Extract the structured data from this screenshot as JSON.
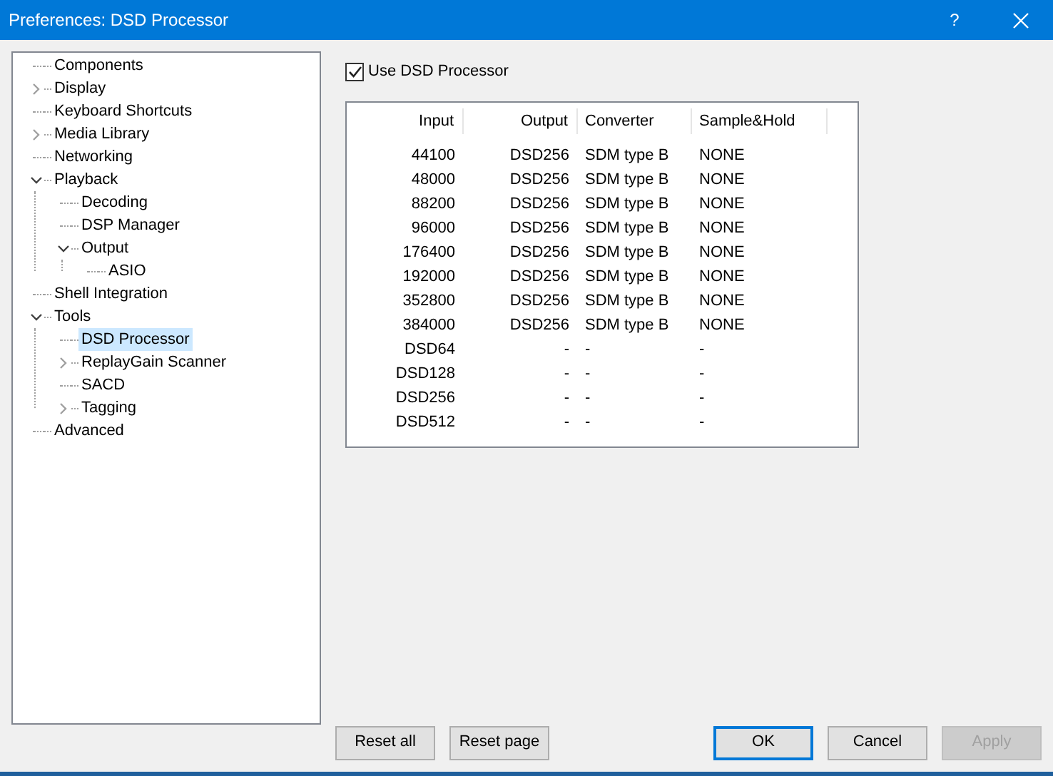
{
  "window": {
    "title": "Preferences: DSD Processor",
    "help": "?"
  },
  "tree": [
    {
      "label": "Components",
      "selected": false
    },
    {
      "label": "Display",
      "selected": false,
      "expanded": false
    },
    {
      "label": "Keyboard Shortcuts",
      "selected": false
    },
    {
      "label": "Media Library",
      "selected": false,
      "expanded": false
    },
    {
      "label": "Networking",
      "selected": false
    },
    {
      "label": "Playback",
      "selected": false,
      "expanded": true,
      "children": [
        {
          "label": "Decoding",
          "selected": false
        },
        {
          "label": "DSP Manager",
          "selected": false
        },
        {
          "label": "Output",
          "selected": false,
          "expanded": true,
          "children": [
            {
              "label": "ASIO",
              "selected": false
            }
          ]
        }
      ]
    },
    {
      "label": "Shell Integration",
      "selected": false
    },
    {
      "label": "Tools",
      "selected": false,
      "expanded": true,
      "children": [
        {
          "label": "DSD Processor",
          "selected": true
        },
        {
          "label": "ReplayGain Scanner",
          "selected": false,
          "expanded": false
        },
        {
          "label": "SACD",
          "selected": false
        },
        {
          "label": "Tagging",
          "selected": false,
          "expanded": false
        }
      ]
    },
    {
      "label": "Advanced",
      "selected": false
    }
  ],
  "use_processor": {
    "label": "Use DSD Processor",
    "checked": true
  },
  "table": {
    "columns": [
      "Input",
      "Output",
      "Converter",
      "Sample&Hold"
    ],
    "rows": [
      [
        "44100",
        "DSD256",
        "SDM type B",
        "NONE"
      ],
      [
        "48000",
        "DSD256",
        "SDM type B",
        "NONE"
      ],
      [
        "88200",
        "DSD256",
        "SDM type B",
        "NONE"
      ],
      [
        "96000",
        "DSD256",
        "SDM type B",
        "NONE"
      ],
      [
        "176400",
        "DSD256",
        "SDM type B",
        "NONE"
      ],
      [
        "192000",
        "DSD256",
        "SDM type B",
        "NONE"
      ],
      [
        "352800",
        "DSD256",
        "SDM type B",
        "NONE"
      ],
      [
        "384000",
        "DSD256",
        "SDM type B",
        "NONE"
      ],
      [
        "DSD64",
        "-",
        "-",
        "-"
      ],
      [
        "DSD128",
        "-",
        "-",
        "-"
      ],
      [
        "DSD256",
        "-",
        "-",
        "-"
      ],
      [
        "DSD512",
        "-",
        "-",
        "-"
      ]
    ]
  },
  "buttons": [
    {
      "label": "Reset all",
      "default": false,
      "disabled": false
    },
    {
      "label": "Reset page",
      "default": false,
      "disabled": false
    },
    {
      "label": "OK",
      "default": true,
      "disabled": false
    },
    {
      "label": "Cancel",
      "default": false,
      "disabled": false
    },
    {
      "label": "Apply",
      "default": false,
      "disabled": true
    }
  ]
}
